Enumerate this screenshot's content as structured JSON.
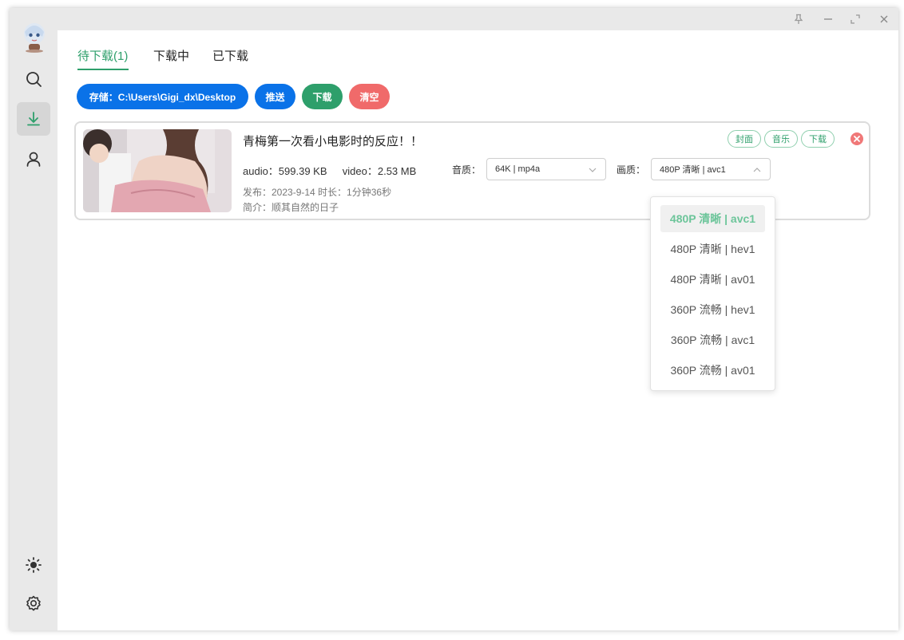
{
  "tabs": [
    {
      "label": "待下载(1)"
    },
    {
      "label": "下载中"
    },
    {
      "label": "已下载"
    }
  ],
  "toolbar": {
    "storage_label": "存储：C:\\Users\\Gigi_dx\\Desktop",
    "push_label": "推送",
    "download_label": "下载",
    "clear_label": "清空"
  },
  "item": {
    "title": "青梅第一次看小电影时的反应！！",
    "audio_size": "audio：599.39 KB",
    "video_size": "video：2.53 MB",
    "publish": "发布：2023-9-14 时长：1分钟36秒",
    "intro": "简介：顺其自然的日子",
    "audio_quality_label": "音质：",
    "audio_quality_value": "64K | mp4a",
    "video_quality_label": "画质：",
    "video_quality_value": "480P 清晰 | avc1",
    "tags": [
      "封面",
      "音乐",
      "下载"
    ]
  },
  "quality_options": [
    "480P 清晰 | avc1",
    "480P 清晰 | hev1",
    "480P 清晰 | av01",
    "360P 流畅 | hev1",
    "360P 流畅 | avc1",
    "360P 流畅 | av01"
  ],
  "selected_quality_index": 0,
  "sidebar": {
    "items": [
      "avatar",
      "search-icon",
      "download-icon",
      "user-icon",
      "theme-icon",
      "settings-icon"
    ]
  },
  "colors": {
    "accent_green": "#2e9f6b",
    "accent_blue": "#0a72e8",
    "accent_red": "#f06a6a",
    "close_red": "#f07878"
  }
}
